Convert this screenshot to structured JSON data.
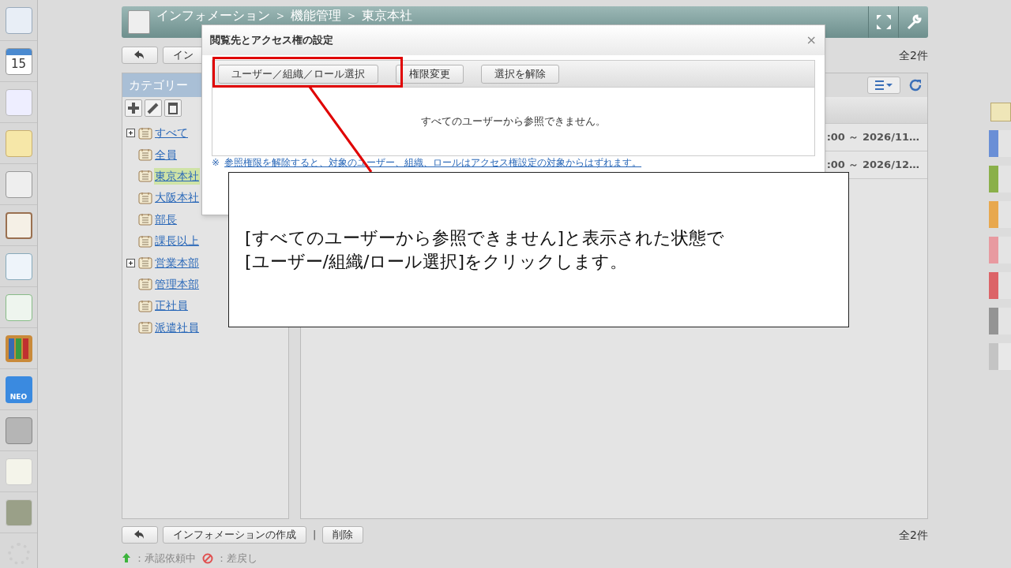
{
  "app_sidebar": {
    "calendar_day": "15",
    "neo_label": "NEO"
  },
  "header": {
    "breadcrumb": "インフォメーション ＞ 機能管理 ＞ 東京本社"
  },
  "top_toolbar": {
    "create_button": "イン",
    "total": "全2件"
  },
  "category_panel": {
    "title": "カテゴリー",
    "items": [
      {
        "label": "すべて",
        "selected": false,
        "expandable": true
      },
      {
        "label": "全員",
        "selected": false,
        "expandable": false
      },
      {
        "label": "東京本社",
        "selected": true,
        "expandable": false
      },
      {
        "label": "大阪本社",
        "selected": false,
        "expandable": false
      },
      {
        "label": "部長",
        "selected": false,
        "expandable": false
      },
      {
        "label": "課長以上",
        "selected": false,
        "expandable": false
      },
      {
        "label": "営業本部",
        "selected": false,
        "expandable": true
      },
      {
        "label": "管理本部",
        "selected": false,
        "expandable": false
      },
      {
        "label": "正社員",
        "selected": false,
        "expandable": false
      },
      {
        "label": "派遣社員",
        "selected": false,
        "expandable": false
      }
    ]
  },
  "list": {
    "rows": [
      {
        "period": ":00 ～ 2026/11…"
      },
      {
        "period": ":00 ～ 2026/12…"
      }
    ]
  },
  "bottom_toolbar": {
    "create_button": "インフォメーションの作成",
    "separator": "|",
    "delete_button": "削除",
    "total": "全2件"
  },
  "legend": [
    {
      "kind": "pending",
      "label": "：承認依頼中"
    },
    {
      "kind": "rejected",
      "label": "：差戻し"
    }
  ],
  "right_tabs": [
    {
      "color": "#6a8fd6"
    },
    {
      "color": "#8ab04a"
    },
    {
      "color": "#e8a84e"
    },
    {
      "color": "#e89aa0"
    },
    {
      "color": "#dc6468"
    },
    {
      "color": "#949494"
    }
  ],
  "dialog": {
    "title": "閲覧先とアクセス権の設定",
    "close": "×",
    "buttons": [
      "ユーザー／組織／ロール選択",
      "権限変更",
      "選択を解除"
    ],
    "message": "すべてのユーザーから参照できません。",
    "note_mark": "※",
    "note": "参照権限を解除すると、対象のユーザー、組織、ロールはアクセス権設定の対象からはずれます。"
  },
  "callout": {
    "lines": [
      "[すべてのユーザーから参照できません]と表示された状態で",
      "[ユーザー/組織/ロール選択]をクリックします。"
    ]
  }
}
